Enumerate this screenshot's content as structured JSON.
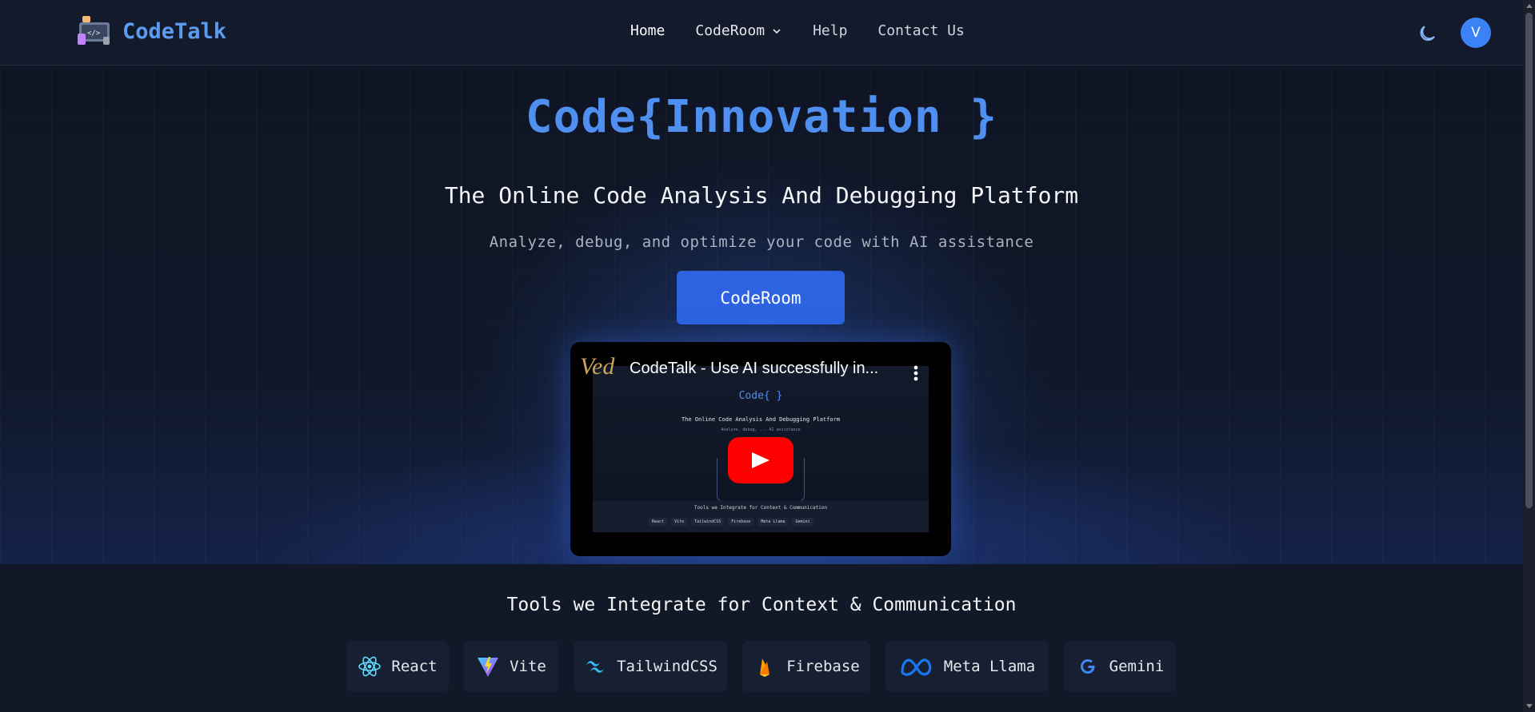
{
  "brand": {
    "name": "CodeTalk"
  },
  "nav": {
    "items": [
      {
        "label": "Home"
      },
      {
        "label": "CodeRoom"
      },
      {
        "label": "Help"
      },
      {
        "label": "Contact Us"
      }
    ],
    "avatar_initial": "V"
  },
  "hero": {
    "title": "Code{Innovation }",
    "subtitle": "The Online Code Analysis And Debugging Platform",
    "description": "Analyze, debug, and optimize your code with AI assistance",
    "cta_label": "CodeRoom"
  },
  "video": {
    "title": "CodeTalk - Use AI successfully in...",
    "channel_mark": "Ved",
    "preview_title": "Code{ }",
    "preview_subtitle": "The Online Code Analysis And Debugging Platform",
    "preview_description": "Analyze, debug, ... AI assistance",
    "preview_tools_title": "Tools we Integrate for Context & Communication",
    "preview_tools": [
      "React",
      "Vite",
      "TailwindCSS",
      "Firebase",
      "Meta Llama",
      "Gemini"
    ]
  },
  "tools": {
    "title": "Tools we Integrate for Context & Communication",
    "items": [
      {
        "label": "React",
        "icon": "react-icon"
      },
      {
        "label": "Vite",
        "icon": "vite-icon"
      },
      {
        "label": "TailwindCSS",
        "icon": "tailwind-icon"
      },
      {
        "label": "Firebase",
        "icon": "firebase-icon"
      },
      {
        "label": "Meta Llama",
        "icon": "meta-icon"
      },
      {
        "label": "Gemini",
        "icon": "google-icon"
      }
    ]
  },
  "colors": {
    "accent": "#4f8ff0",
    "cta": "#2d63e0",
    "background": "#0f1524",
    "youtube_red": "#ff0000"
  }
}
